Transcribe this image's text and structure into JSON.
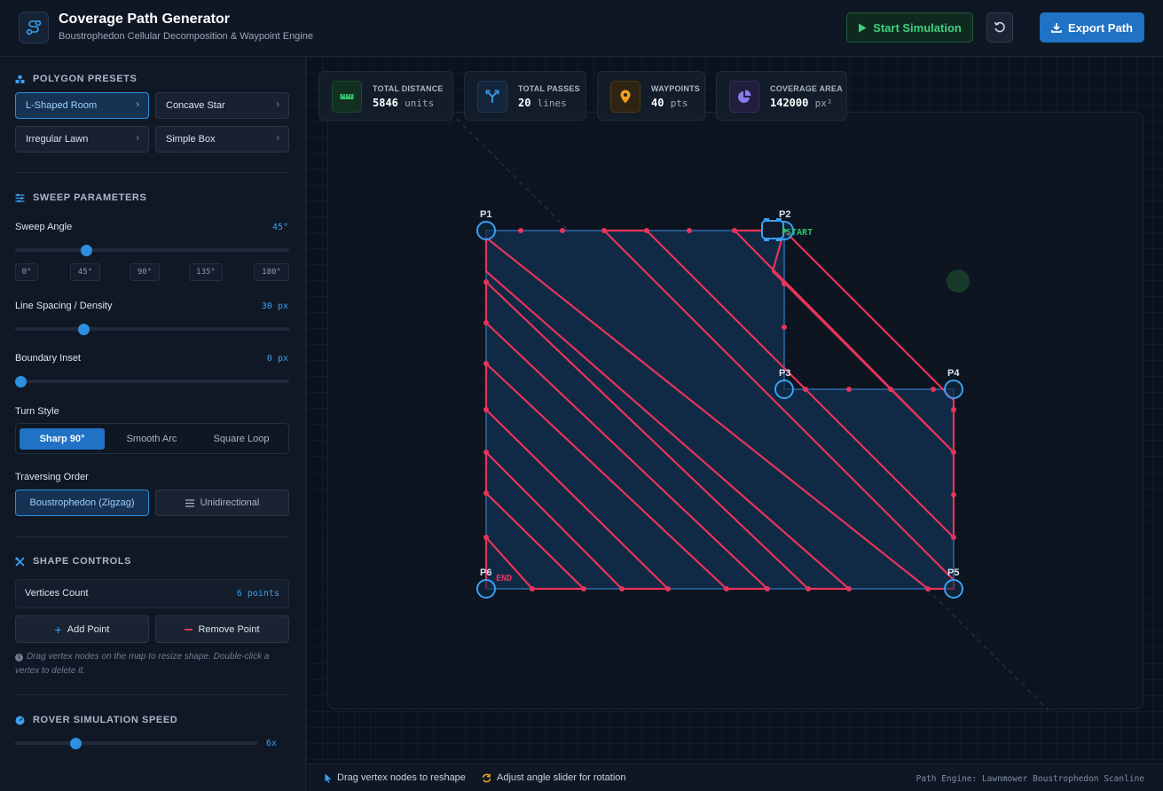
{
  "header": {
    "title": "Coverage Path Generator",
    "subtitle": "Boustrophedon Cellular Decomposition & Waypoint Engine",
    "start_sim_label": "Start Simulation",
    "export_label": "Export Path"
  },
  "sidebar": {
    "presets": {
      "heading": "POLYGON PRESETS",
      "items": [
        "L-Shaped Room",
        "Concave Star",
        "Irregular Lawn",
        "Simple Box"
      ],
      "active": "L-Shaped Room"
    },
    "sweep": {
      "heading": "SWEEP PARAMETERS",
      "angle_label": "Sweep Angle",
      "angle_value": "45°",
      "angle_fraction": 0.25,
      "angle_ticks": [
        "0°",
        "45°",
        "90°",
        "135°",
        "180°"
      ],
      "spacing_label": "Line Spacing / Density",
      "spacing_value": "30 px",
      "spacing_fraction": 0.24,
      "inset_label": "Boundary Inset",
      "inset_value": "0 px",
      "inset_fraction": 0.0,
      "turn_label": "Turn Style",
      "turn_options": [
        "Sharp 90°",
        "Smooth Arc",
        "Square Loop"
      ],
      "turn_active": "Sharp 90°",
      "order_label": "Traversing Order",
      "order_options": [
        "Boustrophedon (Zigzag)",
        "Unidirectional"
      ],
      "order_active": "Boustrophedon (Zigzag)"
    },
    "shape": {
      "heading": "SHAPE CONTROLS",
      "vertices_label": "Vertices Count",
      "vertices_value": "6 points",
      "add_label": "Add Point",
      "remove_label": "Remove Point",
      "hint": "Drag vertex nodes on the map to resize shape. Double-click a vertex to delete it."
    },
    "rover": {
      "heading": "ROVER SIMULATION SPEED",
      "speed_value": "6x",
      "speed_fraction": 0.24
    }
  },
  "stats": [
    {
      "title": "TOTAL DISTANCE",
      "value": "5846",
      "unit": "units",
      "icon": "ruler-icon",
      "color": "#2fbf6b"
    },
    {
      "title": "TOTAL PASSES",
      "value": "20",
      "unit": "lines",
      "icon": "split-arrows-icon",
      "color": "#3ba0f0"
    },
    {
      "title": "WAYPOINTS",
      "value": "40",
      "unit": "pts",
      "icon": "map-pin-icon",
      "color": "#f0a020"
    },
    {
      "title": "COVERAGE AREA",
      "value": "142000",
      "unit": "px²",
      "icon": "pie-chart-icon",
      "color": "#8a7cf0"
    }
  ],
  "map": {
    "vertex_labels": [
      "P1",
      "P2",
      "P3",
      "P4",
      "P5",
      "P6"
    ],
    "start_label": "START",
    "end_label": "END",
    "colors": {
      "polygon": "#2c8fe0",
      "path": "#e8345a",
      "start": "#2fbf6b",
      "end": "#e8345a"
    }
  },
  "footer": {
    "hint_drag": "Drag vertex nodes to reshape",
    "hint_angle": "Adjust angle slider for rotation",
    "engine": "Path Engine: Lawnmower Boustrophedon Scanline"
  }
}
